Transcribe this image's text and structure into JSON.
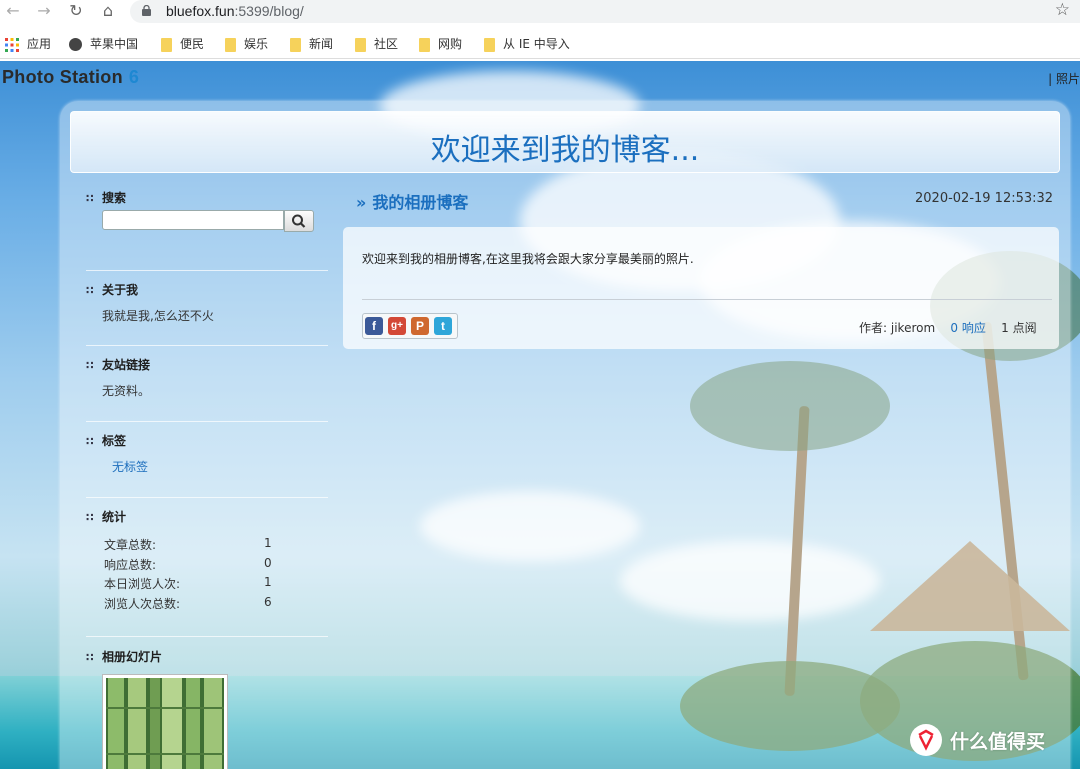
{
  "browser": {
    "url_host": "bluefox.fun",
    "url_rest": ":5399/blog/",
    "bookmarks": [
      {
        "label": "应用",
        "icon": "apps-grid-icon"
      },
      {
        "label": "苹果中国",
        "icon": "globe-icon"
      },
      {
        "label": "便民",
        "icon": "folder-icon"
      },
      {
        "label": "娱乐",
        "icon": "folder-icon"
      },
      {
        "label": "新闻",
        "icon": "folder-icon"
      },
      {
        "label": "社区",
        "icon": "folder-icon"
      },
      {
        "label": "网购",
        "icon": "folder-icon"
      },
      {
        "label": "从 IE 中导入",
        "icon": "folder-icon"
      }
    ]
  },
  "app": {
    "logo_text": "Photo Station",
    "logo_version": "6",
    "header_right": "| 照片"
  },
  "blog": {
    "title": "欢迎来到我的博客..."
  },
  "sidebar": {
    "search": {
      "heading": "搜索",
      "placeholder": ""
    },
    "about": {
      "heading": "关于我",
      "text": "我就是我,怎么还不火"
    },
    "links": {
      "heading": "友站链接",
      "text": "无资料。"
    },
    "tags": {
      "heading": "标签",
      "text": "无标签"
    },
    "stats": {
      "heading": "统计",
      "rows": [
        {
          "label": "文章总数:",
          "value": "1"
        },
        {
          "label": "响应总数:",
          "value": "0"
        },
        {
          "label": "本日浏览人次:",
          "value": "1"
        },
        {
          "label": "浏览人次总数:",
          "value": "6"
        }
      ]
    },
    "slideshow": {
      "heading": "相册幻灯片"
    }
  },
  "post": {
    "title": "我的相册博客",
    "date": "2020-02-19 12:53:32",
    "body": "欢迎来到我的相册博客,在这里我将会跟大家分享最美丽的照片.",
    "author_label": "作者:",
    "author": "jikerom",
    "responses": "0 响应",
    "views": "1 点阅",
    "share_icons": [
      {
        "name": "facebook-share-icon",
        "glyph": "f",
        "color": "#3b5998"
      },
      {
        "name": "google-plus-share-icon",
        "glyph": "g+",
        "color": "#d34836"
      },
      {
        "name": "plurk-share-icon",
        "glyph": "P",
        "color": "#cf682f"
      },
      {
        "name": "twitter-share-icon",
        "glyph": "t",
        "color": "#2fa6d9"
      }
    ]
  },
  "watermark": {
    "text": "什么值得买"
  }
}
